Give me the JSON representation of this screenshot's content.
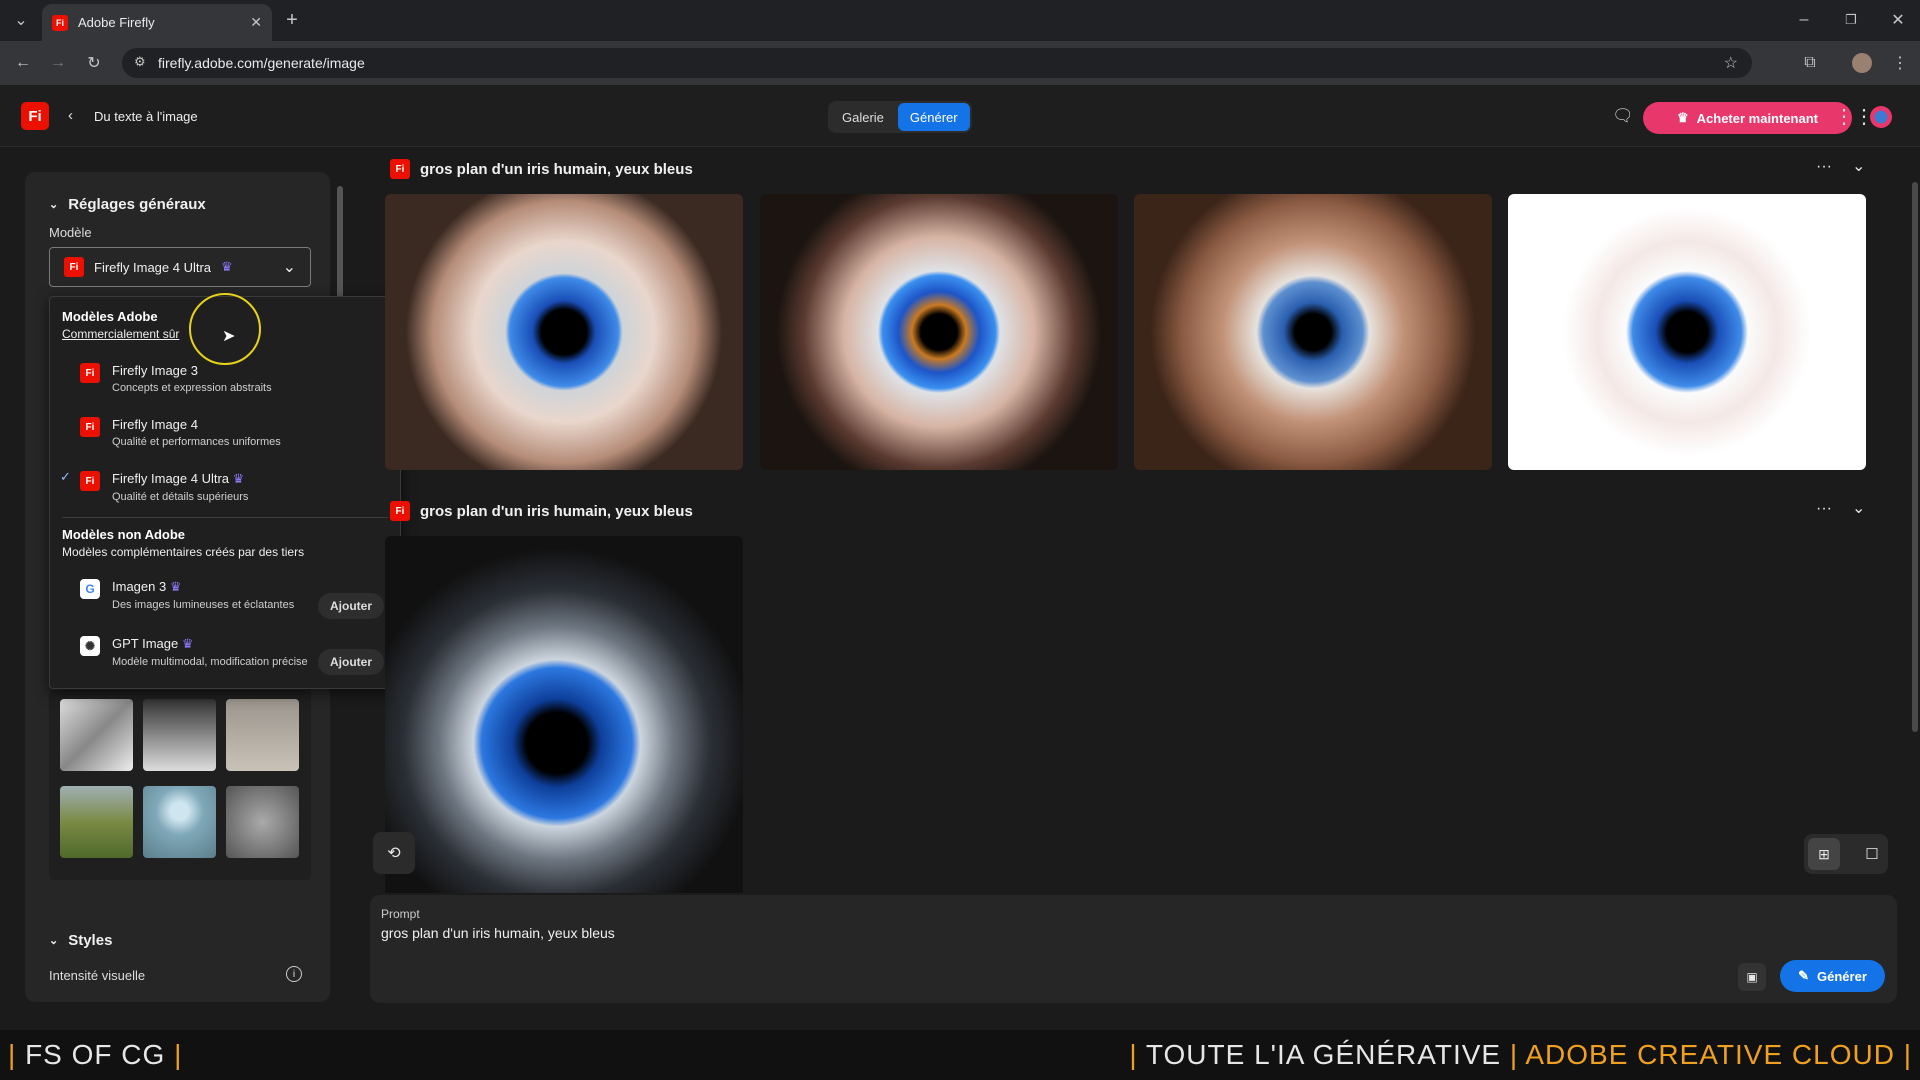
{
  "browser": {
    "tab_title": "Adobe Firefly",
    "tab_favicon": "Fi",
    "url": "firefly.adobe.com/generate/image"
  },
  "header": {
    "logo": "Fi",
    "back_label": "Du texte à l'image",
    "tabs": [
      {
        "label": "Galerie"
      },
      {
        "label": "Générer"
      }
    ],
    "buy_label": "Acheter maintenant"
  },
  "left_panel": {
    "general_title": "Réglages généraux",
    "model_label": "Modèle",
    "model_selected": "Firefly Image 4 Ultra",
    "styles_title": "Styles",
    "visual_intensity_label": "Intensité visuelle"
  },
  "dropdown": {
    "adobe_header": "Modèles Adobe",
    "adobe_sub": "Commercialement sûr",
    "adobe_models": [
      {
        "name": "Firefly Image 3",
        "desc": "Concepts et expression abstraits",
        "selected": false,
        "premium": false
      },
      {
        "name": "Firefly Image 4",
        "desc": "Qualité et performances uniformes",
        "selected": false,
        "premium": false
      },
      {
        "name": "Firefly Image 4 Ultra",
        "desc": "Qualité et détails supérieurs",
        "selected": true,
        "premium": true
      }
    ],
    "non_adobe_header": "Modèles non Adobe",
    "non_adobe_sub": "Modèles complémentaires créés par des tiers",
    "non_adobe_models": [
      {
        "name": "Imagen 3",
        "desc": "Des images lumineuses et éclatantes",
        "action": "Ajouter",
        "icon": "G"
      },
      {
        "name": "GPT Image",
        "desc": "Modèle multimodal, modification précise",
        "action": "Ajouter",
        "icon": "✺"
      }
    ]
  },
  "gallery": {
    "rows": [
      {
        "prompt": "gros plan d'un iris humain, yeux bleus"
      },
      {
        "prompt": "gros plan d'un iris humain, yeux bleus"
      }
    ]
  },
  "prompt": {
    "label": "Prompt",
    "value": "gros plan d'un iris humain, yeux bleus",
    "generate_label": "Générer"
  },
  "banner": {
    "left": "FS OF CG",
    "right_1": "TOUTE L'IA GÉNÉRATIVE",
    "right_2": "ADOBE CREATIVE CLOUD"
  },
  "colors": {
    "accent": "#1473e6",
    "brand": "#eb1000",
    "buy": "#e8376a",
    "banner_accent": "#f0a020"
  }
}
